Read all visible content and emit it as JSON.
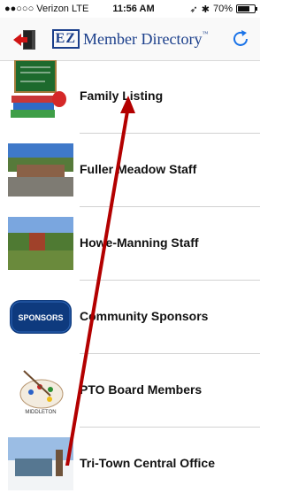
{
  "status_bar": {
    "signal": "●●○○○",
    "carrier": "Verizon",
    "network": "LTE",
    "time": "11:56 AM",
    "battery_percent": "70%",
    "battery_level": 0.7
  },
  "header": {
    "brand_badge": "EZ",
    "title": "Member Directory",
    "trademark": "™",
    "exit_icon": "exit-icon",
    "refresh_icon": "refresh-icon"
  },
  "list": {
    "items": [
      {
        "label": "Family Listing",
        "icon": "books-directory-icon"
      },
      {
        "label": "Fuller Meadow Staff",
        "icon": "school-building-photo"
      },
      {
        "label": "Howe-Manning Staff",
        "icon": "school-building-photo"
      },
      {
        "label": "Community Sponsors",
        "icon": "sponsors-badge"
      },
      {
        "label": "PTO Board Members",
        "icon": "palette-icon"
      },
      {
        "label": "Tri-Town Central Office",
        "icon": "office-building-photo"
      }
    ]
  },
  "sponsor_badge_text": "SPONSORS",
  "palette_text": "MIDDLETON",
  "colors": {
    "brand": "#1b3f8b",
    "annotation_arrow": "#b30000"
  }
}
